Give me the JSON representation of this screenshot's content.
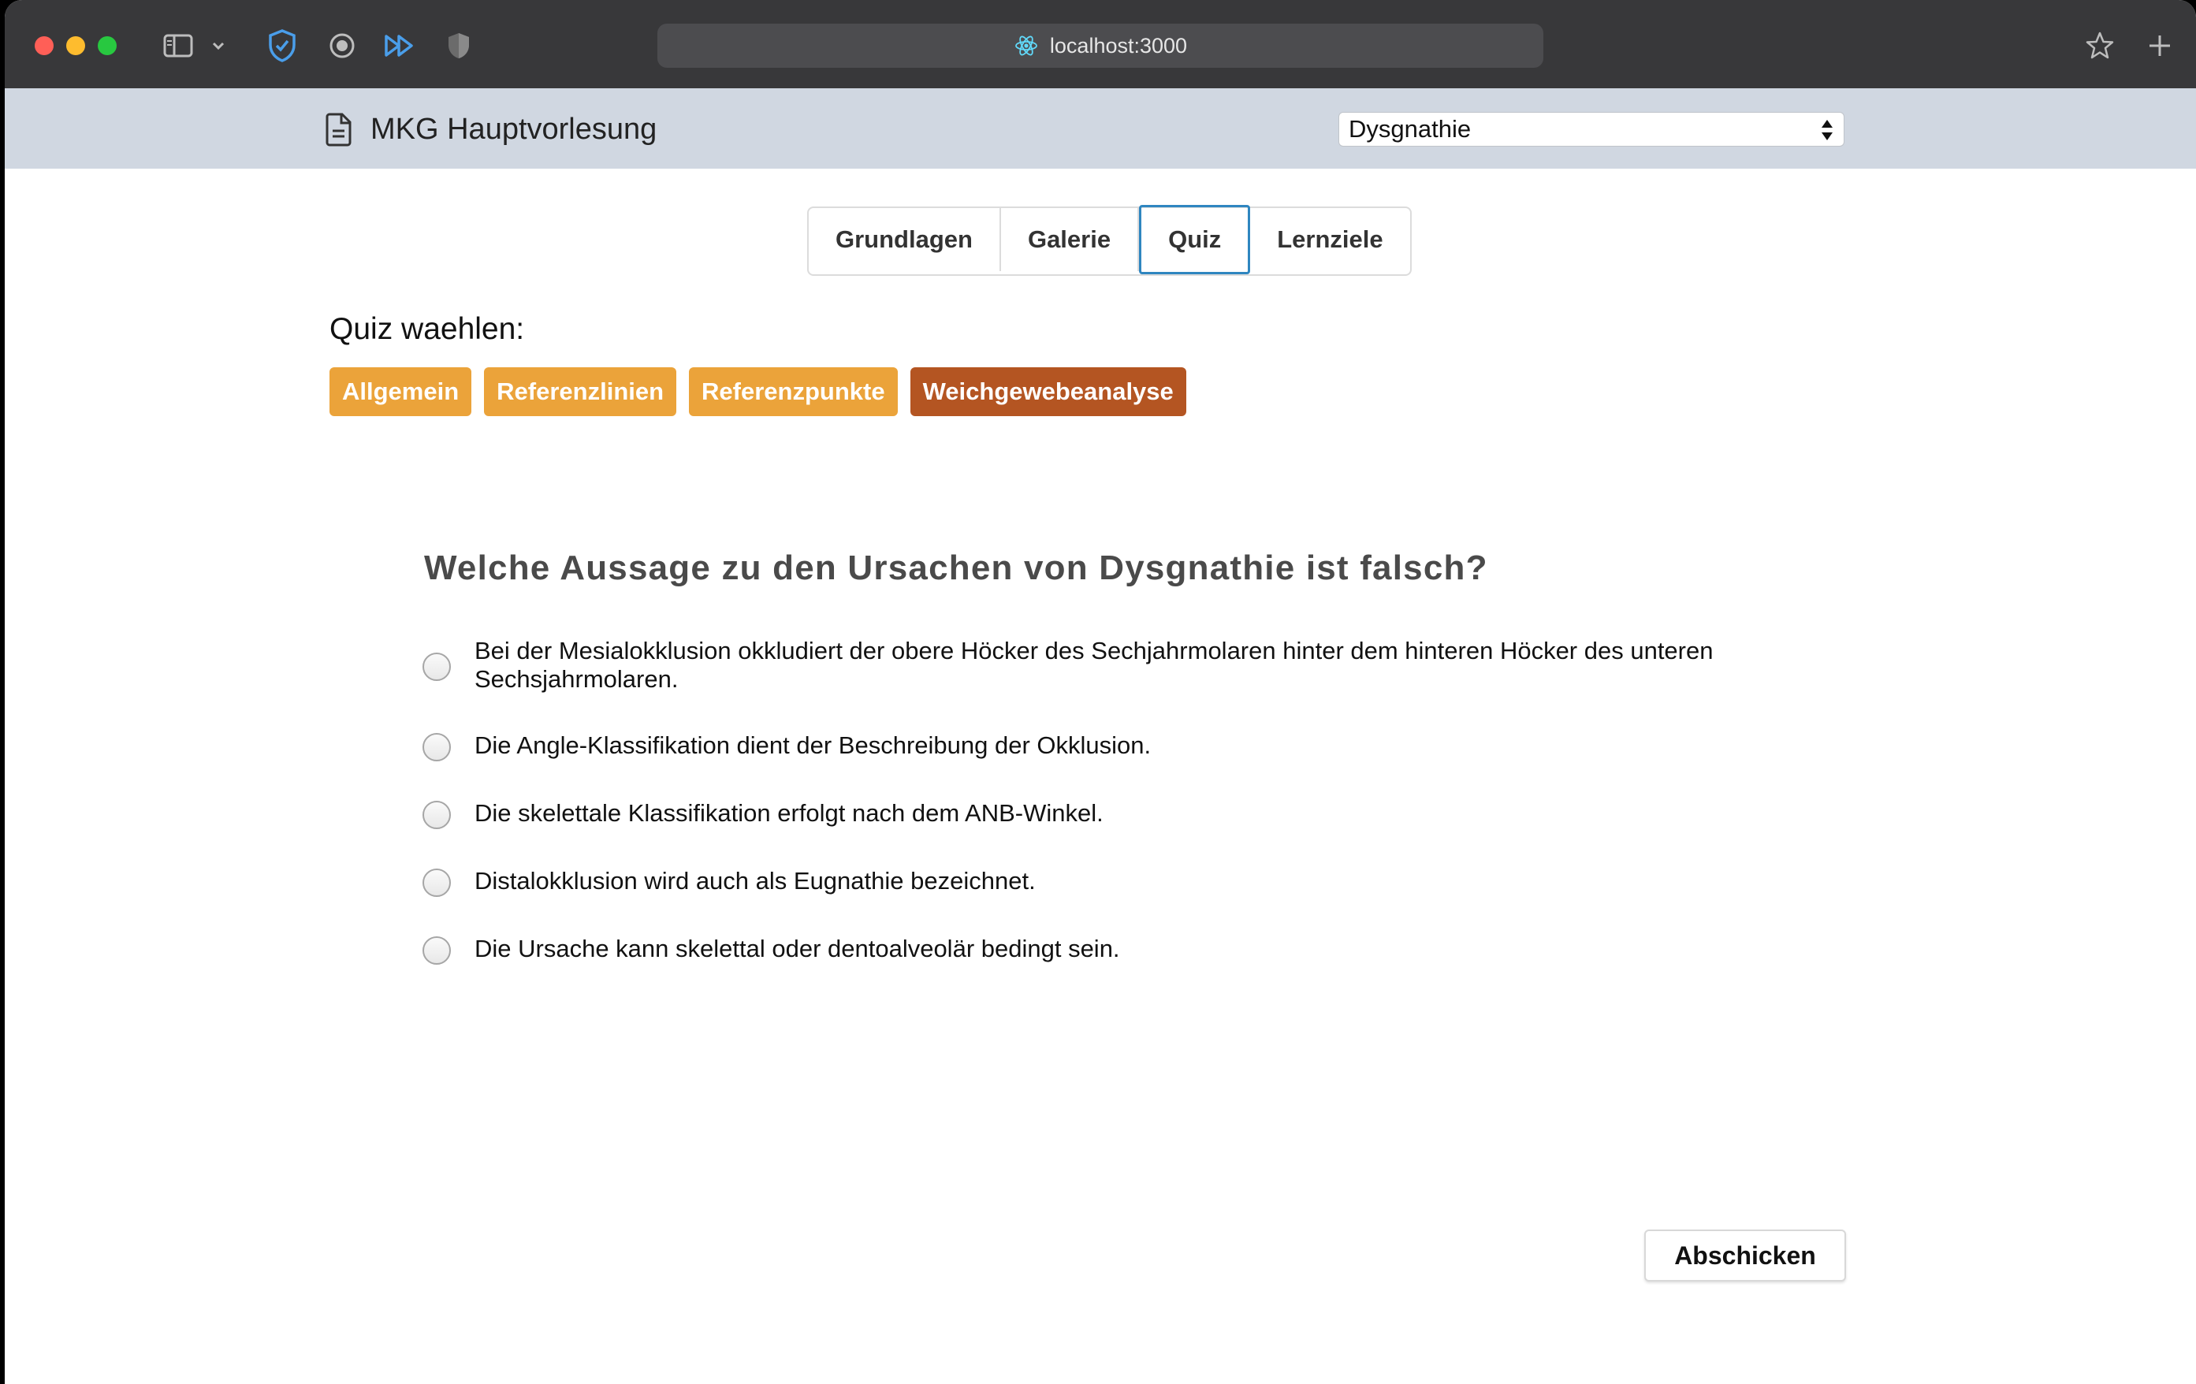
{
  "browser": {
    "url": "localhost:3000"
  },
  "header": {
    "title": "MKG Hauptvorlesung",
    "topic_select": {
      "selected": "Dysgnathie"
    }
  },
  "tabs": [
    {
      "label": "Grundlagen",
      "active": false
    },
    {
      "label": "Galerie",
      "active": false
    },
    {
      "label": "Quiz",
      "active": true
    },
    {
      "label": "Lernziele",
      "active": false
    }
  ],
  "quiz_chooser": {
    "label": "Quiz waehlen:",
    "buttons": [
      {
        "label": "Allgemein",
        "active": false
      },
      {
        "label": "Referenzlinien",
        "active": false
      },
      {
        "label": "Referenzpunkte",
        "active": false
      },
      {
        "label": "Weichgewebeanalyse",
        "active": true
      }
    ]
  },
  "question": {
    "text": "Welche Aussage zu den Ursachen von Dysgnathie ist falsch?",
    "options": [
      {
        "line1": "Bei der Mesialokklusion okkludiert der obere Höcker des Sechjahrmolaren hinter dem hinteren Höcker des unteren",
        "line2": "Sechsjahrmolaren."
      },
      {
        "line1": "Die Angle-Klassifikation dient der Beschreibung der Okklusion."
      },
      {
        "line1": "Die skelettale Klassifikation erfolgt nach dem ANB-Winkel."
      },
      {
        "line1": "Distalokklusion wird auch als Eugnathie bezeichnet."
      },
      {
        "line1": "Die Ursache kann skelettal oder dentoalveolär bedingt sein."
      }
    ]
  },
  "submit_label": "Abschicken",
  "colors": {
    "quiz_button": "#eba33a",
    "quiz_button_active": "#b45522",
    "header_bg": "#d0d7e1",
    "tab_active_border": "#2f86c0"
  }
}
